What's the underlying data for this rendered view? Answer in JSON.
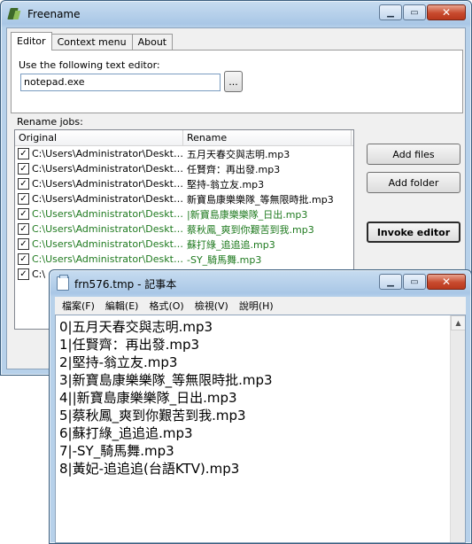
{
  "freename": {
    "title": "Freename",
    "tabs": [
      "Editor",
      "Context menu",
      "About"
    ],
    "editor_label": "Use the following text editor:",
    "editor_value": "notepad.exe",
    "browse_label": "...",
    "rename_jobs_label": "Rename jobs:",
    "columns": [
      "Original",
      "Rename"
    ],
    "rows": [
      {
        "original": "C:\\Users\\Administrator\\Desktop\\...",
        "rename": "五月天春交與志明.mp3",
        "green": false,
        "checked": true
      },
      {
        "original": "C:\\Users\\Administrator\\Desktop\\...",
        "rename": "任賢齊：再出發.mp3",
        "green": false,
        "checked": true
      },
      {
        "original": "C:\\Users\\Administrator\\Desktop\\...",
        "rename": "堅持-翁立友.mp3",
        "green": false,
        "checked": true
      },
      {
        "original": "C:\\Users\\Administrator\\Desktop\\...",
        "rename": "新寶島康樂樂隊_等無限時批.mp3",
        "green": false,
        "checked": true
      },
      {
        "original": "C:\\Users\\Administrator\\Desktop\\...",
        "rename": "|新寶島康樂樂隊_日出.mp3",
        "green": true,
        "checked": true
      },
      {
        "original": "C:\\Users\\Administrator\\Desktop\\...",
        "rename": "蔡秋鳳_爽到你艱苦到我.mp3",
        "green": true,
        "checked": true
      },
      {
        "original": "C:\\Users\\Administrator\\Desktop\\...",
        "rename": "蘇打綠_追追追.mp3",
        "green": true,
        "checked": true
      },
      {
        "original": "C:\\Users\\Administrator\\Desktop\\...",
        "rename": "-SY_騎馬舞.mp3",
        "green": true,
        "checked": true
      },
      {
        "original": "C:\\",
        "rename": "",
        "green": false,
        "checked": true
      }
    ],
    "buttons": {
      "add_files": "Add files",
      "add_folder": "Add folder",
      "invoke_editor": "Invoke editor"
    }
  },
  "notepad": {
    "title": "frn576.tmp - 記事本",
    "menus": [
      "檔案(F)",
      "編輯(E)",
      "格式(O)",
      "檢視(V)",
      "說明(H)"
    ],
    "lines": [
      "0|五月天春交與志明.mp3",
      "1|任賢齊：再出發.mp3",
      "2|堅持-翁立友.mp3",
      "3|新寶島康樂樂隊_等無限時批.mp3",
      "4||新寶島康樂樂隊_日出.mp3",
      "5|蔡秋鳳_爽到你艱苦到我.mp3",
      "6|蘇打綠_追追追.mp3",
      "7|-SY_騎馬舞.mp3",
      "8|黃妃-追追追(台語KTV).mp3"
    ]
  },
  "colors": {
    "green_text": "#1f7a1f",
    "title_gradient_top": "#c7dcf0",
    "title_gradient_bottom": "#a9c7e6"
  }
}
